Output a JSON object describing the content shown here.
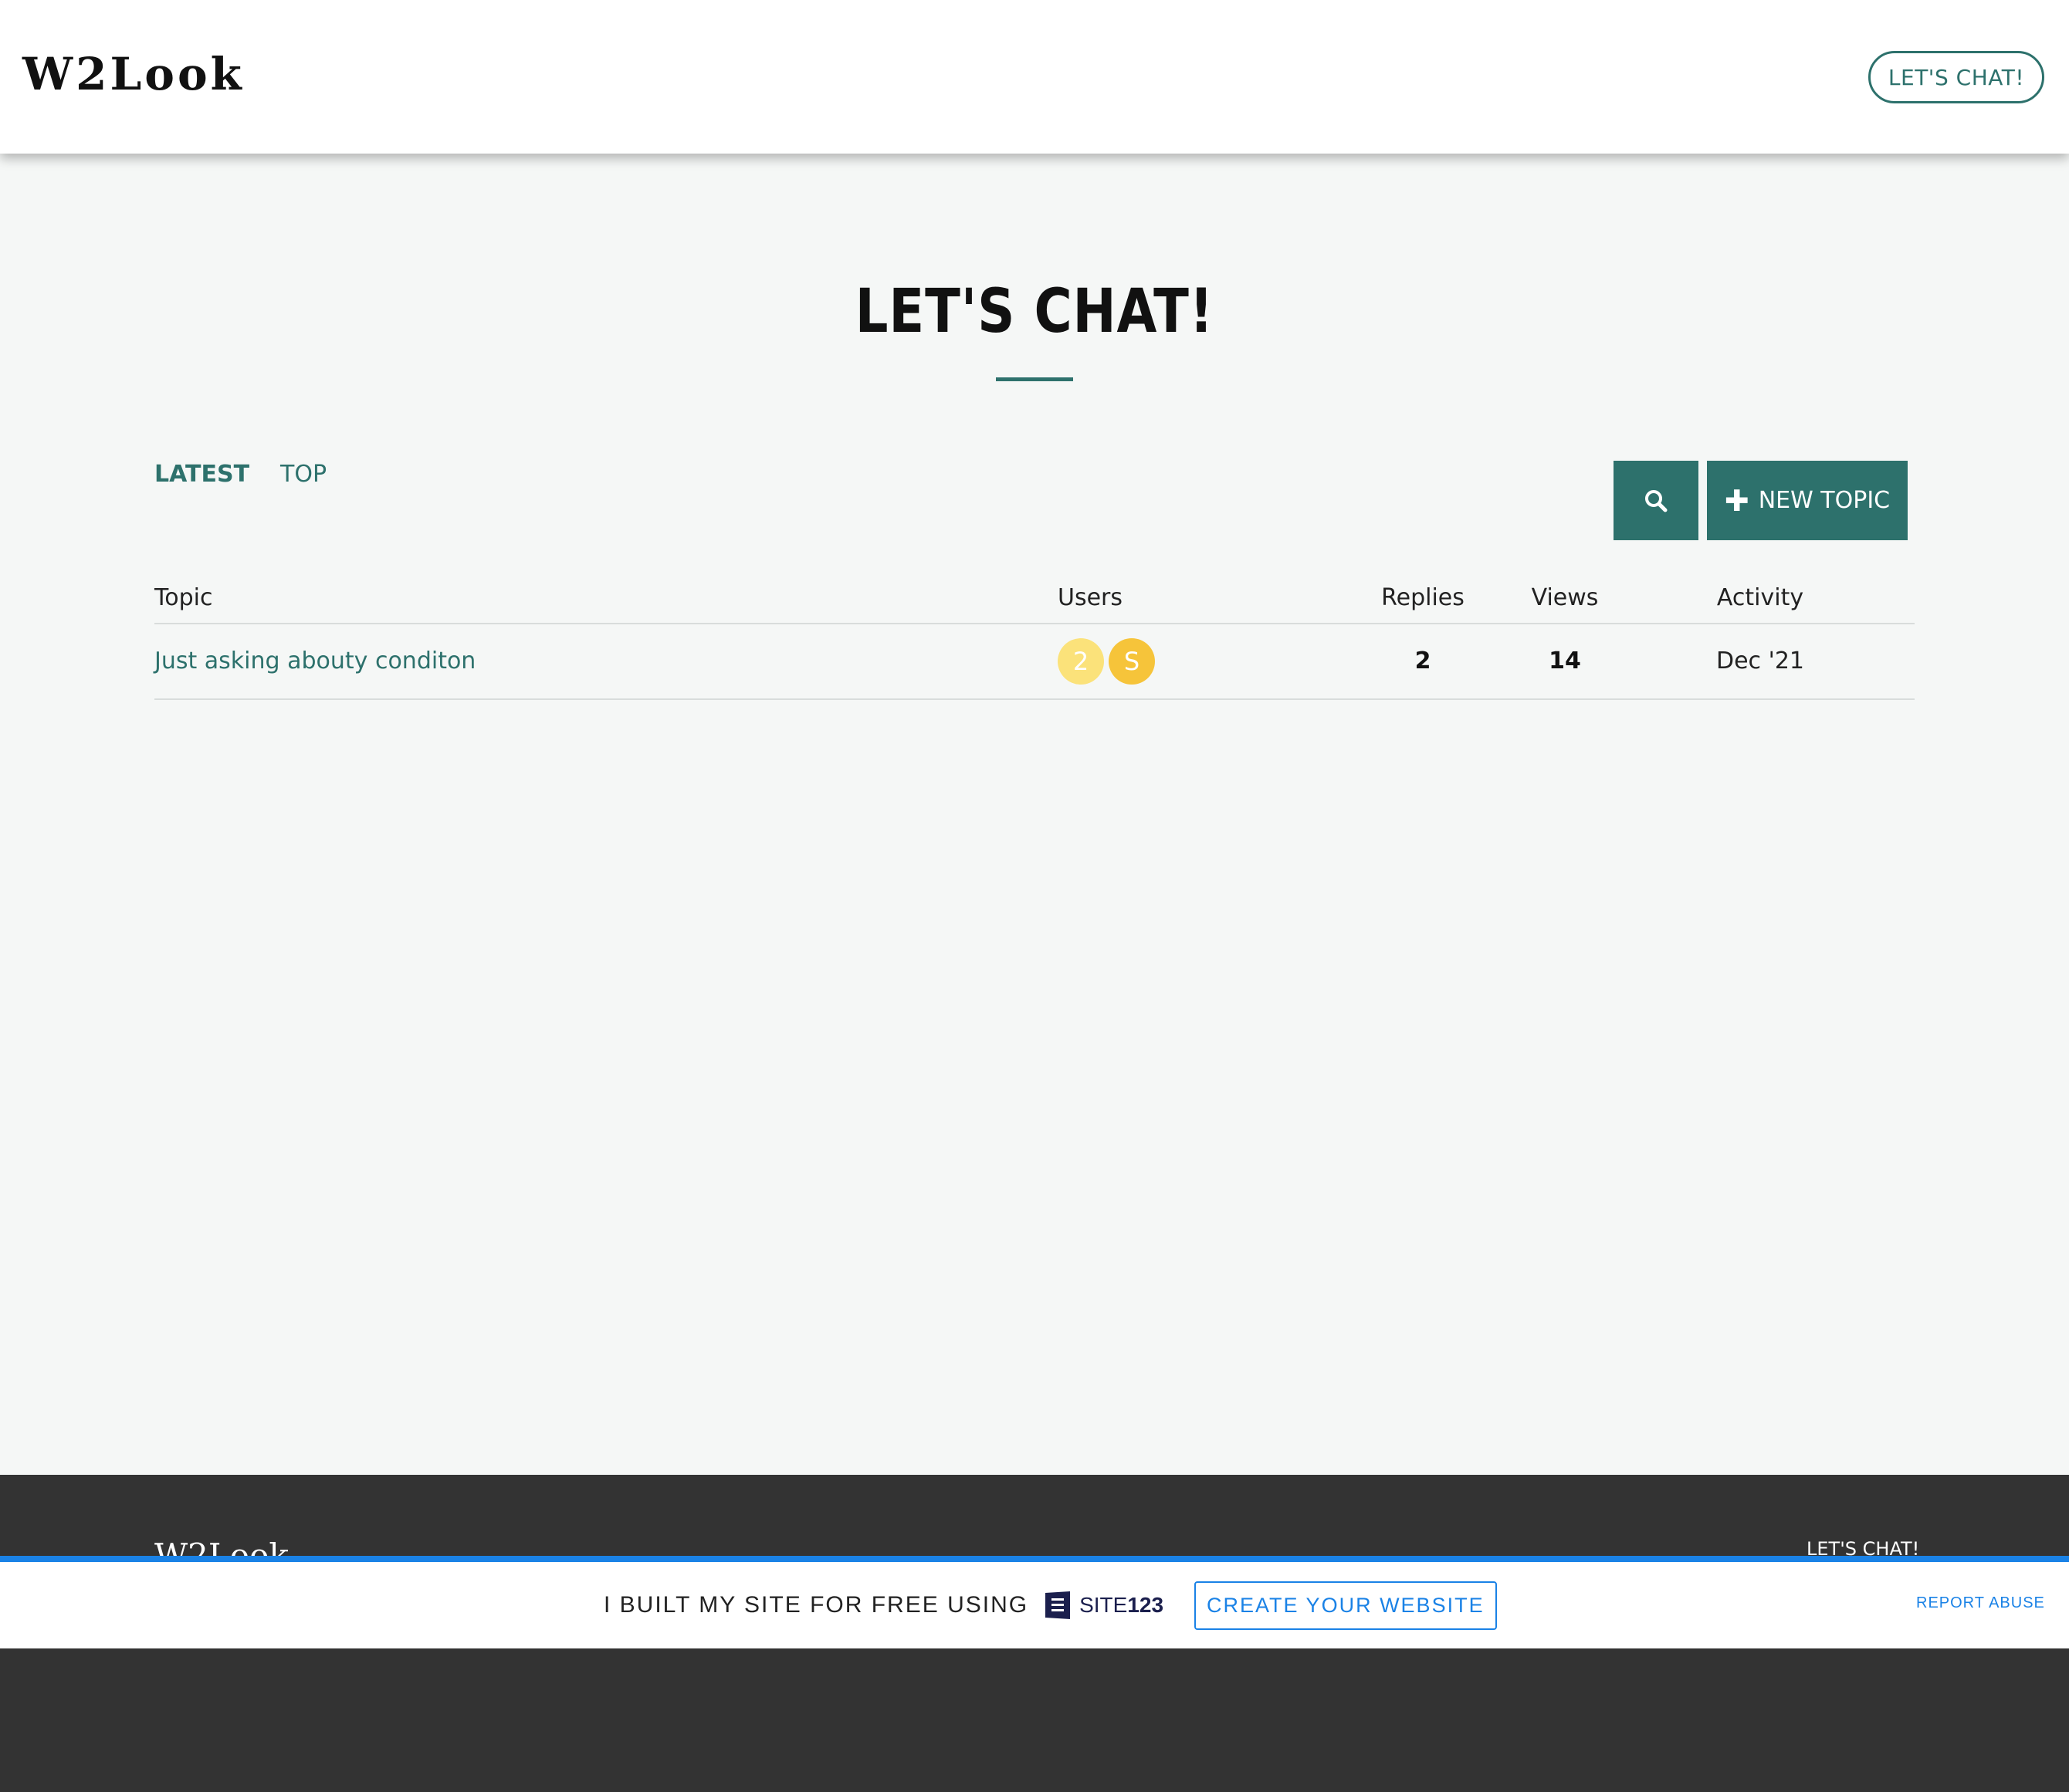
{
  "header": {
    "logo": "W2Look",
    "cta_label": "LET'S CHAT!"
  },
  "main": {
    "title": "LET'S CHAT!",
    "tabs": [
      {
        "label": "LATEST",
        "active": true
      },
      {
        "label": "TOP",
        "active": false
      }
    ],
    "search_icon": "search-icon",
    "new_topic_label": "NEW TOPIC",
    "accent_color": "#2d716c"
  },
  "table": {
    "columns": [
      "Topic",
      "Users",
      "Replies",
      "Views",
      "Activity"
    ],
    "rows": [
      {
        "topic": "Just asking abouty conditon",
        "users": [
          {
            "initial": "2",
            "color": "#fbe27a"
          },
          {
            "initial": "S",
            "color": "#f6c43a"
          }
        ],
        "replies": "2",
        "views": "14",
        "activity": "Dec '21"
      }
    ]
  },
  "footer": {
    "logo": "W2Look",
    "link": "LET'S CHAT!"
  },
  "promo": {
    "text": "I BUILT MY SITE FOR FREE USING",
    "brand_prefix": "SITE",
    "brand_suffix": "123",
    "create_label": "CREATE YOUR WEBSITE",
    "report_label": "REPORT ABUSE",
    "accent_color": "#1a82e6"
  }
}
